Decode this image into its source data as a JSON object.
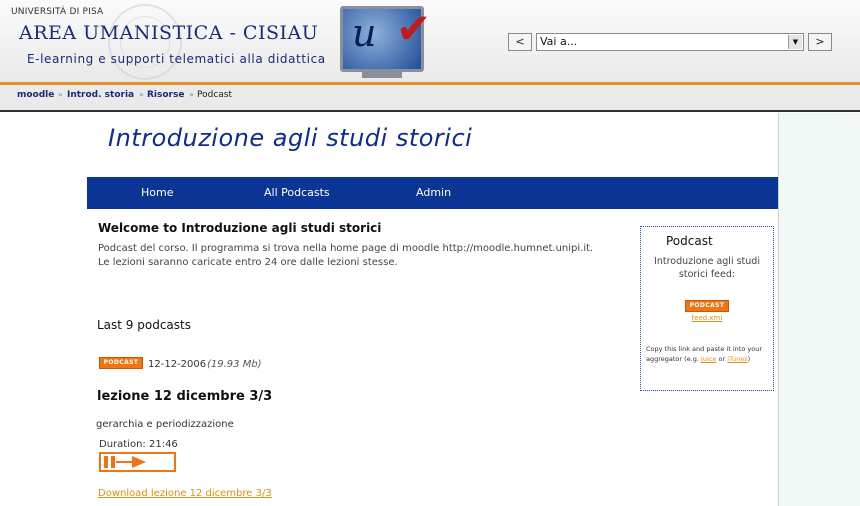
{
  "header": {
    "university": "UNIVERSITÀ DI PISA",
    "title": "AREA UMANISTICA -  CISIAU",
    "subtitle": "E-learning e supporti telematici alla didattica",
    "jump_prev": "<",
    "jump_next": ">",
    "jump_selected": "Vai a..."
  },
  "breadcrumb": {
    "items": [
      "moodle",
      "Introd. storia",
      "Risorse"
    ],
    "current": "Podcast"
  },
  "course": {
    "title": "Introduzione agli studi storici",
    "menu": [
      "Home",
      "All Podcasts",
      "Admin"
    ]
  },
  "welcome": {
    "heading": "Welcome to Introduzione agli studi storici",
    "line1": "Podcast del corso. Il programma si trova nella home page di moodle http://moodle.humnet.unipi.it.",
    "line2": "Le lezioni saranno caricate entro 24 ore dalle lezioni stesse."
  },
  "podcasts": {
    "heading": "Last 9 podcasts",
    "episode": {
      "badge": "PODCAST",
      "date": "12-12-2006",
      "size": "(19.93 Mb)",
      "title": "lezione 12 dicembre 3/3",
      "description": "gerarchia e periodizzazione",
      "duration": "Duration: 21:46",
      "download": "Download lezione 12 dicembre 3/3"
    }
  },
  "sidebar": {
    "title": "Podcast",
    "feed_text_1": "Introduzione agli studi",
    "feed_text_2": "storici feed:",
    "badge": "PODCAST",
    "feed_link": "feed.xml",
    "copy_1": "Copy this link and paste it into",
    "copy_2": "your aggregator (e.g. ",
    "juice": "Juice",
    "or": " or",
    "itunes": "iTunes",
    "copy_end": ")"
  },
  "colors": {
    "accent_orange": "#ef7514",
    "menu_blue": "#0a3595",
    "title_blue": "#0e2b8d"
  }
}
